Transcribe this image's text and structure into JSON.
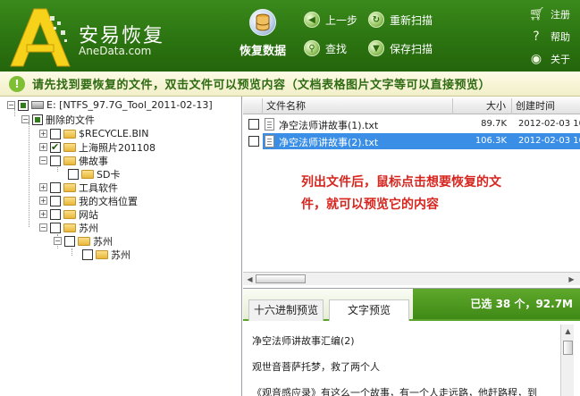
{
  "app": {
    "name": "安易恢复",
    "url": "AneData.com",
    "accent": "#2f7d14",
    "hint_text": "请先找到要恢复的文件，双击文件可以预览内容（文档表格图片文字等可以直接预览）"
  },
  "toolbar": {
    "recover": "恢复数据",
    "prev": "上一步",
    "rescan": "重新扫描",
    "find": "查找",
    "save_scan": "保存扫描"
  },
  "side_menu": {
    "register": "注册",
    "help": "帮助",
    "about": "关于"
  },
  "tree": {
    "root": "E: [NTFS_97.7G_Tool_2011-02-13]",
    "nodes": [
      "删除的文件",
      "$RECYCLE.BIN",
      "上海照片201108",
      "佛故事",
      "SD卡",
      "工具软件",
      "我的文档位置",
      "网站",
      "苏州",
      "苏州",
      "苏州"
    ]
  },
  "filelist": {
    "headers": {
      "name": "文件名称",
      "size": "大小",
      "created": "创建时间"
    },
    "rows": [
      {
        "name": "净空法师讲故事(1).txt",
        "size": "89.7K",
        "created": "2012-02-03 10"
      },
      {
        "name": "净空法师讲故事(2).txt",
        "size": "106.3K",
        "created": "2012-02-03 10"
      }
    ],
    "annotation": "列出文件后，鼠标点击想要恢复的文件，就可以预览它的内容",
    "selected_color": "#3a8ee6"
  },
  "preview": {
    "tab_hex": "十六进制预览",
    "tab_text": "文字预览",
    "stats": "已选 38 个，92.7M",
    "lines": [
      "净空法师讲故事汇编(2)",
      "观世音菩萨托梦，救了两个人",
      "《观音感应录》有这么一个故事，有一个人走远路，他赶路程，到"
    ]
  }
}
